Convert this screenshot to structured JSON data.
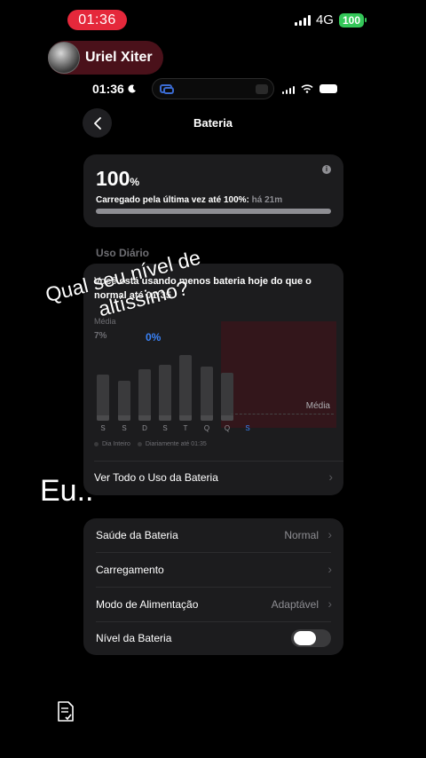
{
  "outer_status": {
    "time": "01:36",
    "network": "4G",
    "battery": "100"
  },
  "profile": {
    "name": "Uriel Xiter"
  },
  "inner_status": {
    "time": "01:36"
  },
  "nav": {
    "title": "Bateria",
    "back_icon": "chevron-left-icon"
  },
  "summary": {
    "percent": "100",
    "percent_sign": "%",
    "last_charged": "Carregado pela última vez até 100%:",
    "last_charged_ago": "há 21m",
    "level": 1.0
  },
  "usage": {
    "section_label": "Uso Diário",
    "message": "Você está usando menos bateria hoje do que o normal até 01:35.",
    "media_label": "Média",
    "media_value_left": "7%",
    "media_value_right": "0%",
    "avg_label": "Média",
    "days": [
      "S",
      "S",
      "D",
      "S",
      "T",
      "Q",
      "Q",
      "S"
    ],
    "active_day_index": 7,
    "legend_full_day": "Dia Inteiro",
    "legend_daily": "Diariamente até 01:35",
    "view_all": "Ver Todo o Uso da Bateria"
  },
  "settings": {
    "rows": [
      {
        "label": "Saúde da Bateria",
        "value": "Normal"
      },
      {
        "label": "Carregamento",
        "value": ""
      },
      {
        "label": "Modo de Alimentação",
        "value": "Adaptável"
      },
      {
        "label": "Nível da Bateria",
        "toggle": false
      }
    ]
  },
  "captions": {
    "line1": "Qual seu nível de",
    "line2": "altíssimo?",
    "line3": "Eu.."
  },
  "colors": {
    "accent": "#3a82f7",
    "status_red": "#e5283b",
    "battery_green": "#34c759",
    "card": "#1c1c1e"
  }
}
